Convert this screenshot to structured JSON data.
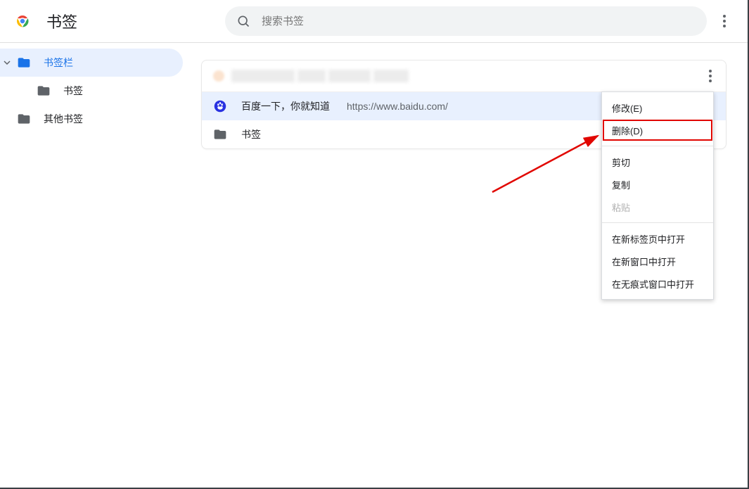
{
  "header": {
    "title": "书签",
    "search_placeholder": "搜索书签"
  },
  "sidebar": {
    "items": [
      {
        "label": "书签栏",
        "selected": true,
        "expanded": true,
        "indent": 0
      },
      {
        "label": "书签",
        "selected": false,
        "expanded": null,
        "indent": 1
      },
      {
        "label": "其他书签",
        "selected": false,
        "expanded": null,
        "indent": 0
      }
    ]
  },
  "main": {
    "rows": [
      {
        "type": "bookmark",
        "title": "百度一下，你就知道",
        "url": "https://www.baidu.com/",
        "highlighted": true,
        "icon": "baidu"
      },
      {
        "type": "folder",
        "title": "书签",
        "highlighted": false
      }
    ]
  },
  "context_menu": {
    "groups": [
      [
        {
          "label": "修改(E)",
          "enabled": true,
          "boxed": false
        },
        {
          "label": "删除(D)",
          "enabled": true,
          "boxed": true
        }
      ],
      [
        {
          "label": "剪切",
          "enabled": true
        },
        {
          "label": "复制",
          "enabled": true
        },
        {
          "label": "粘贴",
          "enabled": false
        }
      ],
      [
        {
          "label": "在新标签页中打开",
          "enabled": true
        },
        {
          "label": "在新窗口中打开",
          "enabled": true
        },
        {
          "label": "在无痕式窗口中打开",
          "enabled": true
        }
      ]
    ]
  }
}
